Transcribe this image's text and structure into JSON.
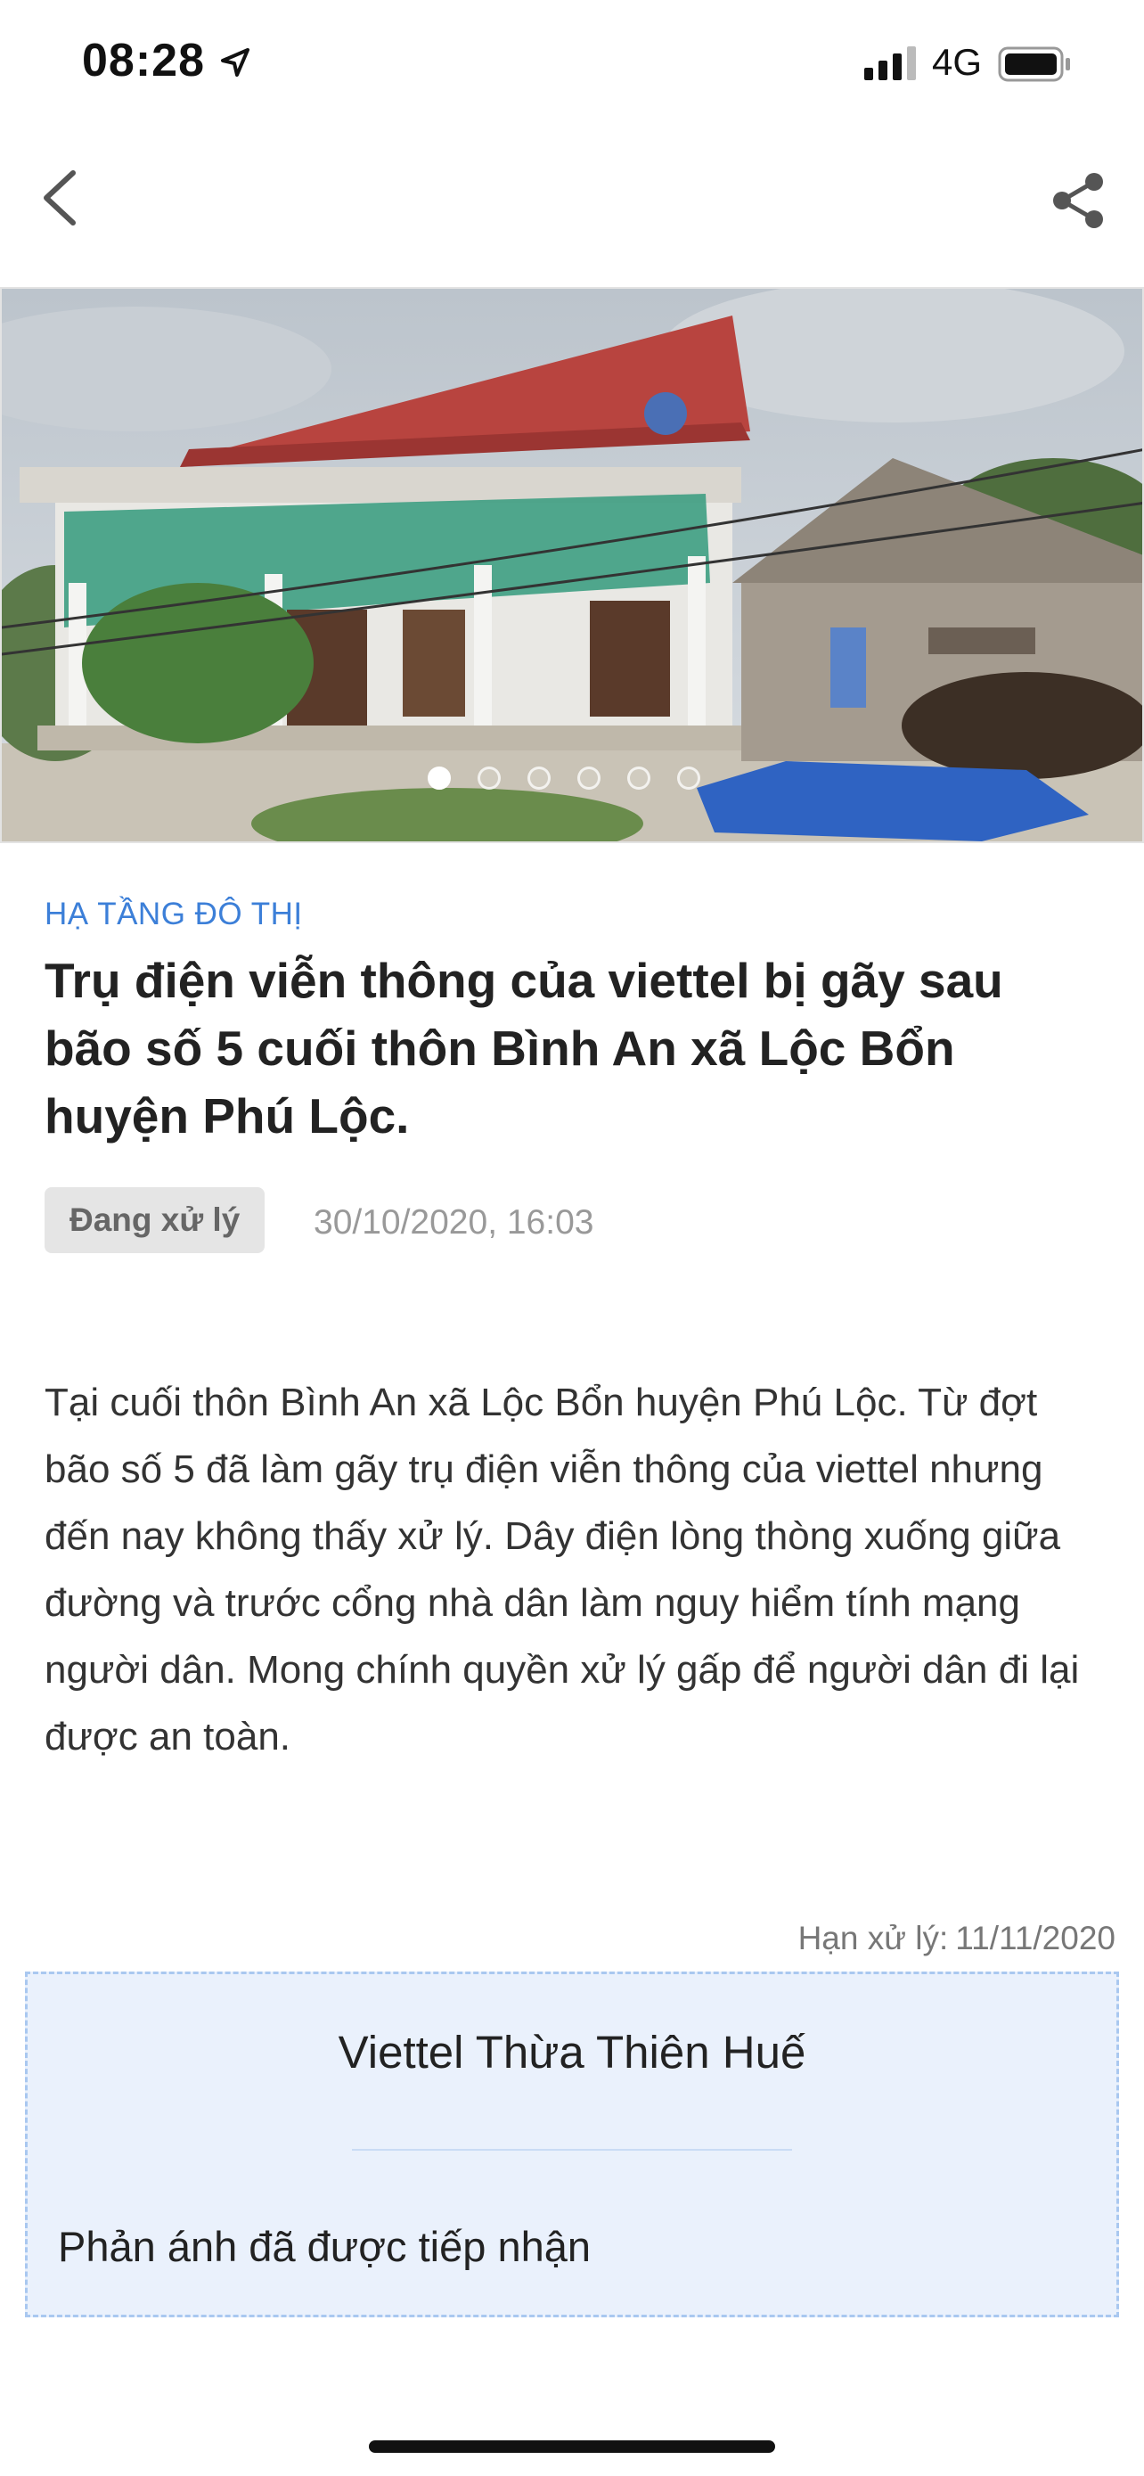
{
  "status_bar": {
    "time": "08:28",
    "network": "4G",
    "icons": [
      "location-arrow-icon",
      "signal-icon",
      "battery-icon"
    ]
  },
  "nav": {
    "back_icon": "chevron-left-icon",
    "share_icon": "share-icon"
  },
  "gallery": {
    "image_count": 6,
    "active_index": 0
  },
  "report": {
    "category": "HẠ TẦNG ĐÔ THỊ",
    "title": "Trụ điện viễn thông của viettel bị gãy sau bão số 5 cuối thôn Bình An xã Lộc Bổn huyện Phú Lộc.",
    "status": "Đang xử lý",
    "timestamp": "30/10/2020, 16:03",
    "description": "Tại cuối thôn Bình An xã Lộc Bổn huyện Phú Lộc. Từ đợt bão số 5 đã làm gãy trụ điện viễn thông của viettel nhưng đến nay không thấy xử lý. Dây điện lòng thòng xuống giữa đường và trước cổng nhà dân làm nguy hiểm tính mạng người dân. Mong chính quyền xử lý gấp để người dân đi lại được an toàn.",
    "deadline_label": "Hạn xử lý:",
    "deadline_value": "11/11/2020"
  },
  "response": {
    "organization": "Viettel Thừa Thiên Huế",
    "message": "Phản ánh đã được tiếp nhận"
  },
  "colors": {
    "accent": "#3c7fd8",
    "badge_bg": "#e5e5e5",
    "response_bg": "#eaf1fc",
    "response_border": "#a9c8f0"
  }
}
